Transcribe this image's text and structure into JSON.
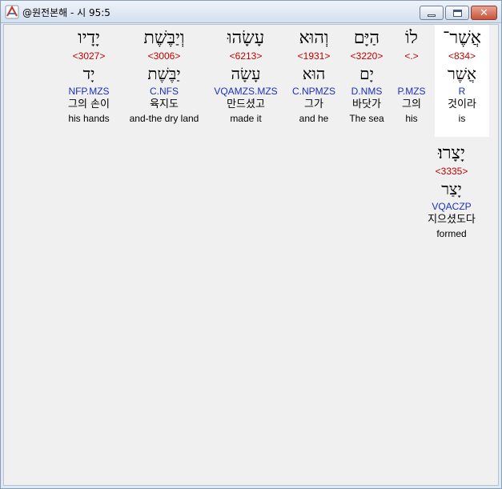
{
  "window": {
    "title": "@원전본해 - 시 95:5"
  },
  "words": [
    {
      "hebrew": "אֲשֶׁר־",
      "strong": "<834>",
      "lemma": "אֲשֶׁר",
      "morph": "R",
      "korean": "것이라",
      "english": "is"
    },
    {
      "hebrew": "לוֹ",
      "strong": "<.>",
      "lemma": "",
      "morph": "P.MZS",
      "korean": "그의",
      "english": "his"
    },
    {
      "hebrew": "הַיָּם",
      "strong": "<3220>",
      "lemma": "יָם",
      "morph": "D.NMS",
      "korean": "바닷가",
      "english": "The sea"
    },
    {
      "hebrew": "וְהוּא",
      "strong": "<1931>",
      "lemma": "הוּא",
      "morph": "C.NPMZS",
      "korean": "그가",
      "english": "and he"
    },
    {
      "hebrew": "עָשָׂהוּ",
      "strong": "<6213>",
      "lemma": "עָשָׂה",
      "morph": "VQAMZS.MZS",
      "korean": "만드셨고",
      "english": "made it"
    },
    {
      "hebrew": "וְיַבֶּשֶׁת",
      "strong": "<3006>",
      "lemma": "יַבֶּשֶׁת",
      "morph": "C.NFS",
      "korean": "육지도",
      "english": "and-the dry land"
    },
    {
      "hebrew": "יָדָיו",
      "strong": "<3027>",
      "lemma": "יָד",
      "morph": "NFP.MZS",
      "korean": "그의 손이",
      "english": "his hands"
    },
    {
      "hebrew": "יָצָרוּ׃",
      "strong": "<3335>",
      "lemma": "יָצַר",
      "morph": "VQACZP",
      "korean": "지으셨도다",
      "english": "formed"
    }
  ]
}
